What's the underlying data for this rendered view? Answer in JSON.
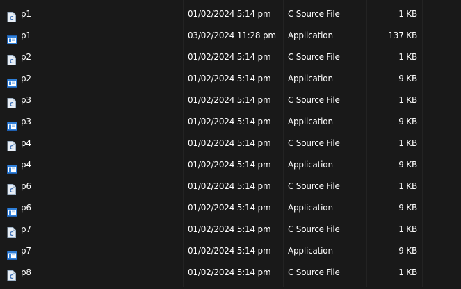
{
  "files": [
    {
      "name": "p1",
      "date": "01/02/2024 5:14 pm",
      "type": "C Source File",
      "size": "1 KB",
      "icon": "c-source-file-icon"
    },
    {
      "name": "p1",
      "date": "03/02/2024 11:28 pm",
      "type": "Application",
      "size": "137 KB",
      "icon": "application-icon"
    },
    {
      "name": "p2",
      "date": "01/02/2024 5:14 pm",
      "type": "C Source File",
      "size": "1 KB",
      "icon": "c-source-file-icon"
    },
    {
      "name": "p2",
      "date": "01/02/2024 5:14 pm",
      "type": "Application",
      "size": "9 KB",
      "icon": "application-icon"
    },
    {
      "name": "p3",
      "date": "01/02/2024 5:14 pm",
      "type": "C Source File",
      "size": "1 KB",
      "icon": "c-source-file-icon"
    },
    {
      "name": "p3",
      "date": "01/02/2024 5:14 pm",
      "type": "Application",
      "size": "9 KB",
      "icon": "application-icon"
    },
    {
      "name": "p4",
      "date": "01/02/2024 5:14 pm",
      "type": "C Source File",
      "size": "1 KB",
      "icon": "c-source-file-icon"
    },
    {
      "name": "p4",
      "date": "01/02/2024 5:14 pm",
      "type": "Application",
      "size": "9 KB",
      "icon": "application-icon"
    },
    {
      "name": "p6",
      "date": "01/02/2024 5:14 pm",
      "type": "C Source File",
      "size": "1 KB",
      "icon": "c-source-file-icon"
    },
    {
      "name": "p6",
      "date": "01/02/2024 5:14 pm",
      "type": "Application",
      "size": "9 KB",
      "icon": "application-icon"
    },
    {
      "name": "p7",
      "date": "01/02/2024 5:14 pm",
      "type": "C Source File",
      "size": "1 KB",
      "icon": "c-source-file-icon"
    },
    {
      "name": "p7",
      "date": "01/02/2024 5:14 pm",
      "type": "Application",
      "size": "9 KB",
      "icon": "application-icon"
    },
    {
      "name": "p8",
      "date": "01/02/2024 5:14 pm",
      "type": "C Source File",
      "size": "1 KB",
      "icon": "c-source-file-icon"
    }
  ],
  "colors": {
    "background": "#191919",
    "text": "#ffffff",
    "c_file_icon_page": "#e8eef5",
    "c_file_icon_letter": "#3b6fb6",
    "app_icon_frame": "#2f7fd8",
    "app_icon_body": "#ffffff"
  }
}
